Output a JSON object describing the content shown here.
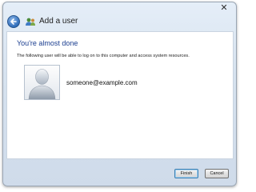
{
  "window": {
    "title": "Add a user",
    "close_symbol": "✕"
  },
  "page": {
    "heading": "You're almost done",
    "description": "The following user will be able to log on to this computer and access system resources.",
    "user_email": "someone@example.com"
  },
  "footer": {
    "finish_label": "Finish",
    "cancel_label": "Cancel"
  },
  "icons": {
    "back": "back-arrow-icon",
    "title": "users-icon",
    "avatar": "user-avatar-icon"
  },
  "colors": {
    "heading": "#1a3d8f",
    "back_button": "#2f6db9"
  }
}
